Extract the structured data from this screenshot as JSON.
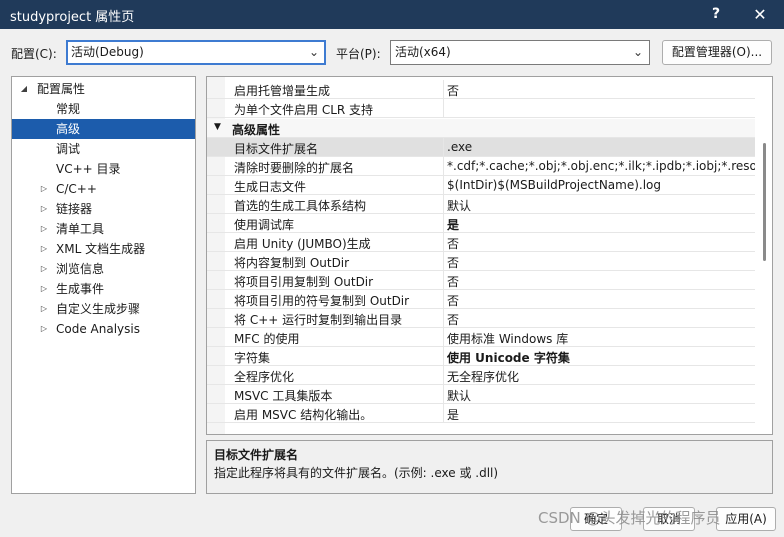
{
  "window": {
    "title": "studyproject 属性页",
    "help_glyph": "?",
    "close_glyph": "✕"
  },
  "toolbar": {
    "config_label": "配置(C):",
    "config_value": "活动(Debug)",
    "platform_label": "平台(P):",
    "platform_value": "活动(x64)",
    "config_manager_label": "配置管理器(O)..."
  },
  "tree": {
    "items": [
      {
        "label": "配置属性",
        "arrow": "◢",
        "selected": false
      },
      {
        "label": "常规",
        "arrow": "",
        "selected": false
      },
      {
        "label": "高级",
        "arrow": "",
        "selected": true
      },
      {
        "label": "调试",
        "arrow": "",
        "selected": false
      },
      {
        "label": "VC++ 目录",
        "arrow": "",
        "selected": false
      },
      {
        "label": "C/C++",
        "arrow": "▷",
        "selected": false
      },
      {
        "label": "链接器",
        "arrow": "▷",
        "selected": false
      },
      {
        "label": "清单工具",
        "arrow": "▷",
        "selected": false
      },
      {
        "label": "XML 文档生成器",
        "arrow": "▷",
        "selected": false
      },
      {
        "label": "浏览信息",
        "arrow": "▷",
        "selected": false
      },
      {
        "label": "生成事件",
        "arrow": "▷",
        "selected": false
      },
      {
        "label": "自定义生成步骤",
        "arrow": "▷",
        "selected": false
      },
      {
        "label": "Code Analysis",
        "arrow": "▷",
        "selected": false
      }
    ]
  },
  "grid": {
    "rows": [
      {
        "name": "启用托管增量生成",
        "value": "否"
      },
      {
        "name": "为单个文件启用 CLR 支持",
        "value": ""
      },
      {
        "name": "高级属性",
        "value": "",
        "category": true,
        "caret": "▼"
      },
      {
        "name": "目标文件扩展名",
        "value": ".exe",
        "selected": true
      },
      {
        "name": "清除时要删除的扩展名",
        "value": "*.cdf;*.cache;*.obj;*.obj.enc;*.ilk;*.ipdb;*.iobj;*.resources"
      },
      {
        "name": "生成日志文件",
        "value": "$(IntDir)$(MSBuildProjectName).log"
      },
      {
        "name": "首选的生成工具体系结构",
        "value": "默认"
      },
      {
        "name": "使用调试库",
        "value": "是",
        "bold": true
      },
      {
        "name": "启用 Unity (JUMBO)生成",
        "value": "否"
      },
      {
        "name": "将内容复制到 OutDir",
        "value": "否"
      },
      {
        "name": "将项目引用复制到 OutDir",
        "value": "否"
      },
      {
        "name": "将项目引用的符号复制到 OutDir",
        "value": "否"
      },
      {
        "name": "将 C++ 运行时复制到输出目录",
        "value": "否"
      },
      {
        "name": "MFC 的使用",
        "value": "使用标准 Windows 库"
      },
      {
        "name": "字符集",
        "value": "使用 Unicode 字符集",
        "bold": true
      },
      {
        "name": "全程序优化",
        "value": "无全程序优化"
      },
      {
        "name": "MSVC 工具集版本",
        "value": "默认"
      },
      {
        "name": "启用 MSVC 结构化输出。",
        "value": "是"
      }
    ]
  },
  "description": {
    "title": "目标文件扩展名",
    "text": "指定此程序将具有的文件扩展名。(示例: .exe 或 .dll)"
  },
  "footer": {
    "ok_label": "确定",
    "cancel_label": "取消",
    "apply_label": "应用(A)"
  },
  "watermark": "CSDN @头发掉光的程序员",
  "colors": {
    "titlebar": "#203a5a",
    "selection": "#1c5cac",
    "focus_border": "#3e7bd1"
  }
}
